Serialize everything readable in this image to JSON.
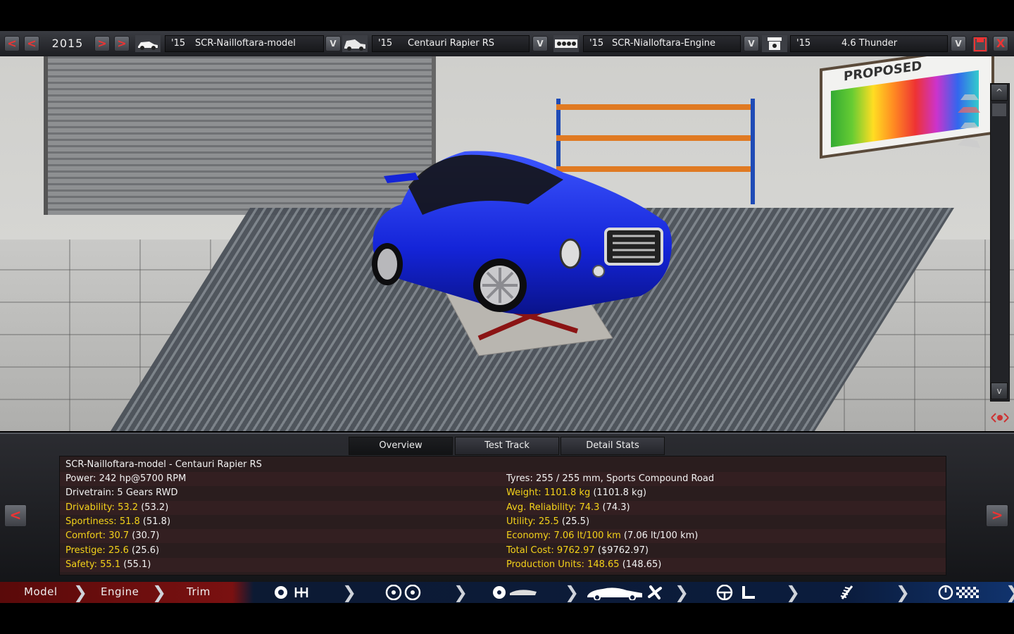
{
  "topbar": {
    "year": "2015",
    "model_select": {
      "year": "'15",
      "name": "SCR-Nailloftara-model"
    },
    "trim_select": {
      "year": "'15",
      "name": "Centauri  Rapier RS"
    },
    "engine_select": {
      "year": "'15",
      "name": "SCR-Nialloftara-Engine"
    },
    "engine_variant_select": {
      "year": "'15",
      "name": "4.6  Thunder"
    },
    "prev_label": "<",
    "next_label": ">",
    "dropdown_label": "V",
    "close_label": "X"
  },
  "scene": {
    "board_title": "PROPOSED"
  },
  "tabs": [
    {
      "label": "Overview",
      "active": true
    },
    {
      "label": "Test Track",
      "active": false
    },
    {
      "label": "Detail Stats",
      "active": false
    }
  ],
  "stats": {
    "title": "SCR-Nailloftara-model - Centauri  Rapier RS",
    "left": [
      {
        "label": "Power: 242 hp@5700 RPM",
        "value": "",
        "paren": ""
      },
      {
        "label": "Drivetrain: 5 Gears RWD",
        "value": "",
        "paren": ""
      },
      {
        "label": "Drivability:",
        "value": "53.2",
        "paren": "(53.2)"
      },
      {
        "label": "Sportiness:",
        "value": "51.8",
        "paren": "(51.8)"
      },
      {
        "label": "Comfort:",
        "value": "30.7",
        "paren": "(30.7)"
      },
      {
        "label": "Prestige:",
        "value": "25.6",
        "paren": "(25.6)"
      },
      {
        "label": "Safety:",
        "value": "55.1",
        "paren": "(55.1)"
      }
    ],
    "right": [
      {
        "label": "Tyres: 255 / 255 mm, Sports Compound Road",
        "value": "",
        "paren": ""
      },
      {
        "label": "Weight:",
        "value": "1101.8 kg",
        "paren": "(1101.8 kg)"
      },
      {
        "label": "Avg. Reliability:",
        "value": "74.3",
        "paren": "(74.3)"
      },
      {
        "label": "Utility:",
        "value": "25.5",
        "paren": "(25.5)"
      },
      {
        "label": "Economy:",
        "value": "7.06 lt/100 km",
        "paren": "(7.06 lt/100 km)"
      },
      {
        "label": "Total Cost:",
        "value": "9762.97",
        "paren": "($9762.97)"
      },
      {
        "label": "Production Units:",
        "value": "148.65",
        "paren": "(148.65)"
      }
    ]
  },
  "steps": {
    "model": "Model",
    "engine": "Engine",
    "trim": "Trim"
  },
  "colors": {
    "accent_red": "#e33333",
    "stat_yellow": "#f4d21a",
    "car_blue": "#1a2ce8"
  }
}
